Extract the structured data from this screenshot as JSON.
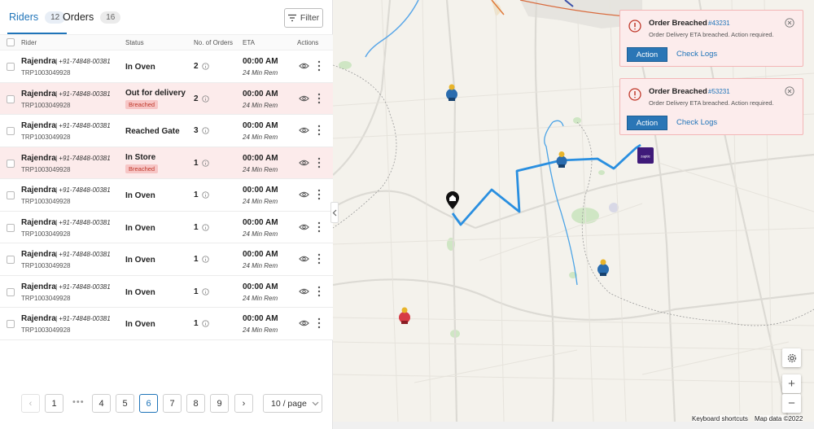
{
  "tabs": [
    {
      "label": "Riders",
      "count": "12",
      "active": true
    },
    {
      "label": "Orders",
      "count": "16",
      "active": false
    }
  ],
  "filter_label": "Filter",
  "columns": {
    "rider": "Rider",
    "status": "Status",
    "orders": "No. of Orders",
    "eta": "ETA",
    "actions": "Actions"
  },
  "rows": [
    {
      "name": "Rajendra",
      "phone": "| +91-74848-00381",
      "id": "TRP1003049928",
      "status": "In Oven",
      "badge": "",
      "orders": "2",
      "eta": "00:00 AM",
      "rem": "24 Min Rem"
    },
    {
      "name": "Rajendra",
      "phone": "| +91-74848-00381",
      "id": "TRP1003049928",
      "status": "Out for delivery",
      "badge": "Breached",
      "orders": "2",
      "eta": "00:00 AM",
      "rem": "24 Min Rem"
    },
    {
      "name": "Rajendra",
      "phone": "| +91-74848-00381",
      "id": "TRP1003049928",
      "status": "Reached Gate",
      "badge": "",
      "orders": "3",
      "eta": "00:00 AM",
      "rem": "24 Min Rem"
    },
    {
      "name": "Rajendra",
      "phone": "| +91-74848-00381",
      "id": "TRP1003049928",
      "status": "In Store",
      "badge": "Breached",
      "orders": "1",
      "eta": "00:00 AM",
      "rem": "24 Min Rem"
    },
    {
      "name": "Rajendra",
      "phone": "| +91-74848-00381",
      "id": "TRP1003049928",
      "status": "In Oven",
      "badge": "",
      "orders": "1",
      "eta": "00:00 AM",
      "rem": "24 Min Rem"
    },
    {
      "name": "Rajendra",
      "phone": "| +91-74848-00381",
      "id": "TRP1003049928",
      "status": "In Oven",
      "badge": "",
      "orders": "1",
      "eta": "00:00 AM",
      "rem": "24 Min Rem"
    },
    {
      "name": "Rajendra",
      "phone": "| +91-74848-00381",
      "id": "TRP1003049928",
      "status": "In Oven",
      "badge": "",
      "orders": "1",
      "eta": "00:00 AM",
      "rem": "24 Min Rem"
    },
    {
      "name": "Rajendra",
      "phone": "| +91-74848-00381",
      "id": "TRP1003049928",
      "status": "In Oven",
      "badge": "",
      "orders": "1",
      "eta": "00:00 AM",
      "rem": "24 Min Rem"
    },
    {
      "name": "Rajendra",
      "phone": "| +91-74848-00381",
      "id": "TRP1003049928",
      "status": "In Oven",
      "badge": "",
      "orders": "1",
      "eta": "00:00 AM",
      "rem": "24 Min Rem"
    }
  ],
  "pagination": {
    "prev": "‹",
    "next": "›",
    "dots": "•••",
    "pages": [
      "1",
      "4",
      "5",
      "6",
      "7",
      "8",
      "9"
    ],
    "current": "6",
    "page_size": "10 / page"
  },
  "alerts": [
    {
      "title": "Order Breached",
      "order_id": "#43231",
      "message": "Order Delivery ETA breached. Action required.",
      "action": "Action",
      "logs": "Check Logs"
    },
    {
      "title": "Order Breached",
      "order_id": "#53231",
      "message": "Order Delivery ETA breached. Action required.",
      "action": "Action",
      "logs": "Check Logs"
    }
  ],
  "map": {
    "store_label": "zaptic",
    "zoom_in": "+",
    "zoom_out": "−",
    "shortcuts": "Keyboard shortcuts",
    "map_data": "Map data ©2022"
  },
  "colors": {
    "accent": "#1f74b9",
    "breached_bg": "#fcebeb",
    "route": "#2a8fe0",
    "alert_border": "#f3b6b6"
  }
}
